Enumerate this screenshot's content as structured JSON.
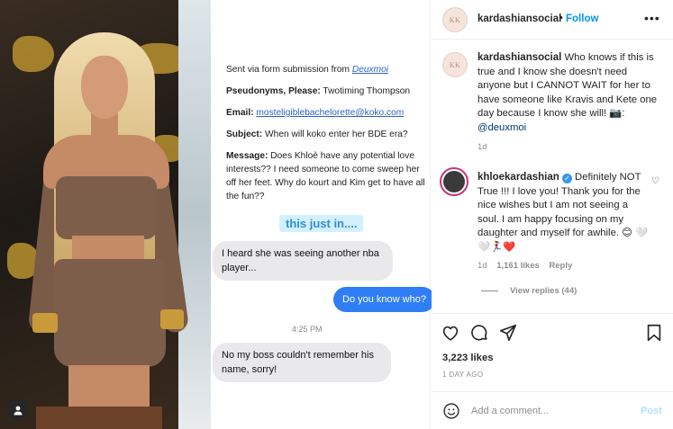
{
  "header": {
    "username": "kardashiansocial",
    "dot": "•",
    "follow_label": "Follow",
    "more_label": "•••",
    "avatar_text": "KK"
  },
  "caption": {
    "username": "kardashiansocial",
    "text": "Who knows if this is true and I know she doesn't need anyone but I CANNOT WAIT for her to have someone like Kravis and Kete one day because I know she will! 📷: ",
    "mention": "@deuxmoi",
    "time": "1d",
    "avatar_text": "KK"
  },
  "reply": {
    "username": "khloekardashian",
    "verified_mark": "✓",
    "text": "Definitely NOT True !!! I love you! Thank you for the nice wishes but I am not seeing a soul. I am happy focusing on my daughter and myself for awhile. 😊 ",
    "emoji_tail": "🤍🤍🏃‍♀️❤️",
    "time": "1d",
    "likes": "1,161 likes",
    "reply_label": "Reply",
    "heart": "♡",
    "view_replies": "View replies (44)"
  },
  "post_meta": {
    "likes": "3,223 likes",
    "ago": "1 DAY AGO"
  },
  "comment_bar": {
    "placeholder": "Add a comment...",
    "post_label": "Post"
  },
  "screenshot": {
    "sent_via": "Sent via form submission from ",
    "sent_via_link": "Deuxmoi",
    "pseudonyms_label": "Pseudonyms, Please:",
    "pseudonyms_value": " Twotiming Thompson",
    "email_label": "Email:",
    "email_value": "mosteligiblebachelorette@koko.com",
    "subject_label": "Subject:",
    "subject_value": " When will koko enter her BDE era?",
    "message_label": "Message:",
    "message_value": " Does Khloè have any potential love interests?? I need someone to come sweep her off her feet. Why do kourt and Kim get to have all the fun??",
    "just_in": "this just in....",
    "msg1": "I heard she was seeing another nba player...",
    "msg2": "Do you know who?",
    "timestamp": "4:25 PM",
    "msg3": "No my boss couldn't remember his name, sorry!"
  },
  "colors": {
    "link_blue": "#0095f6",
    "imessage_blue": "#2f7ef6",
    "bubble_gray": "#e9e9eb",
    "text": "#262626",
    "muted": "#8e8e8e"
  },
  "icons": [
    "person-tag-icon",
    "heart-icon",
    "comment-icon",
    "share-icon",
    "bookmark-icon",
    "emoji-icon",
    "more-icon",
    "verified-icon"
  ]
}
